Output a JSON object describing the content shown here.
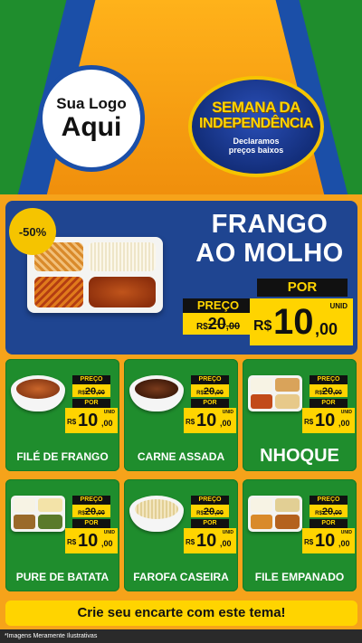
{
  "logo": {
    "line1": "Sua Logo",
    "line2": "Aqui"
  },
  "seal": {
    "title_line1": "SEMANA DA",
    "title_line2": "INDEPENDÊNCIA",
    "subtitle_line1": "Declaramos",
    "subtitle_line2": "preços baixos"
  },
  "featured": {
    "discount": "-50%",
    "name_line1": "FRANGO",
    "name_line2": "AO MOLHO",
    "old_label": "PREÇO",
    "old_currency": "R$",
    "old_int": "20",
    "old_dec": ",00",
    "new_label": "POR",
    "new_currency": "R$",
    "new_int": "10",
    "new_dec": ",00",
    "unit": "UNID"
  },
  "products": [
    {
      "name": "FILÉ DE FRANGO",
      "old_label": "PREÇO",
      "old_currency": "R$",
      "old_int": "20",
      "old_dec": ",00",
      "new_label": "POR",
      "new_currency": "R$",
      "new_int": "10",
      "new_dec": ",00",
      "unit": "UNID"
    },
    {
      "name": "CARNE ASSADA",
      "old_label": "PREÇO",
      "old_currency": "R$",
      "old_int": "20",
      "old_dec": ",00",
      "new_label": "POR",
      "new_currency": "R$",
      "new_int": "10",
      "new_dec": ",00",
      "unit": "UNID"
    },
    {
      "name": "NHOQUE",
      "old_label": "PREÇO",
      "old_currency": "R$",
      "old_int": "20",
      "old_dec": ",00",
      "new_label": "POR",
      "new_currency": "R$",
      "new_int": "10",
      "new_dec": ",00",
      "unit": "UNID"
    },
    {
      "name": "PURE DE BATATA",
      "old_label": "PREÇO",
      "old_currency": "R$",
      "old_int": "20",
      "old_dec": ",00",
      "new_label": "POR",
      "new_currency": "R$",
      "new_int": "10",
      "new_dec": ",00",
      "unit": "UNID"
    },
    {
      "name": "FAROFA CASEIRA",
      "old_label": "PREÇO",
      "old_currency": "R$",
      "old_int": "20",
      "old_dec": ",00",
      "new_label": "POR",
      "new_currency": "R$",
      "new_int": "10",
      "new_dec": ",00",
      "unit": "UNID"
    },
    {
      "name": "FILE EMPANADO",
      "old_label": "PREÇO",
      "old_currency": "R$",
      "old_int": "20",
      "old_dec": ",00",
      "new_label": "POR",
      "new_currency": "R$",
      "new_int": "10",
      "new_dec": ",00",
      "unit": "UNID"
    }
  ],
  "cta": "Crie seu encarte com este tema!",
  "disclaimer": "*Imagens Meramente Ilustrativas",
  "colors": {
    "green": "#1f8d2d",
    "blue": "#1f4591",
    "yellow": "#ffd400",
    "orange": "#f6a31a"
  }
}
